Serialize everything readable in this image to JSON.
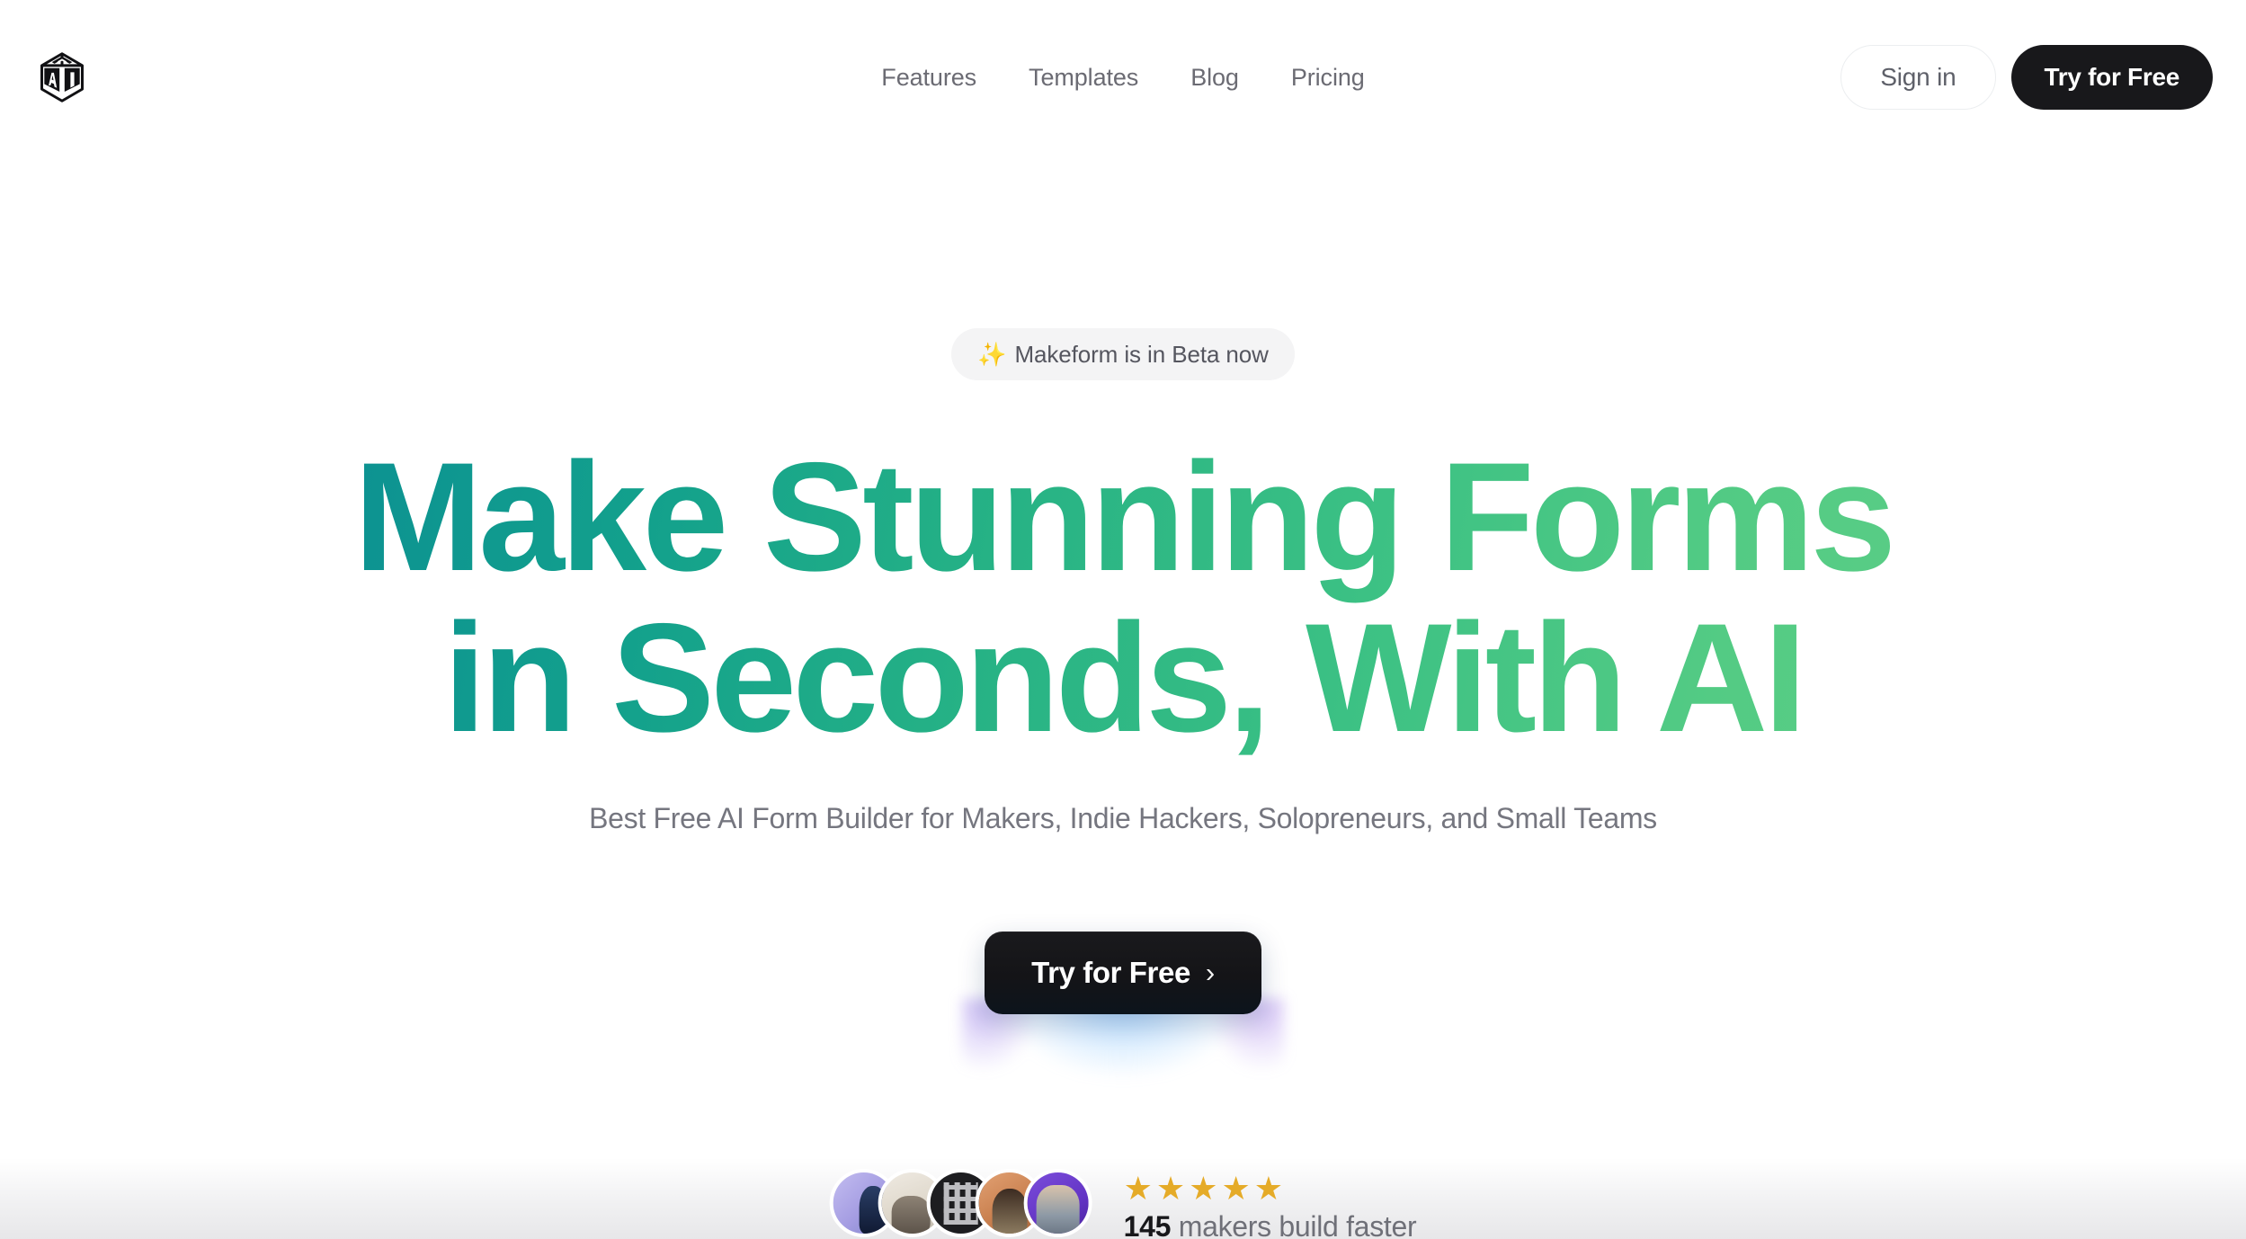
{
  "header": {
    "logo_alt": "Makeform FAI cube logo",
    "nav": [
      {
        "label": "Features"
      },
      {
        "label": "Templates"
      },
      {
        "label": "Blog"
      },
      {
        "label": "Pricing"
      }
    ],
    "sign_in_label": "Sign in",
    "try_free_label": "Try for Free"
  },
  "hero": {
    "badge": {
      "icon": "sparkles-icon",
      "icon_glyph": "✨",
      "text": "Makeform is in Beta now"
    },
    "headline_line1": "Make Stunning Forms",
    "headline_line2": "in Seconds, With AI",
    "subtitle": "Best Free AI Form Builder for Makers, Indie Hackers, Solopreneurs, and Small Teams",
    "cta_label": "Try for Free",
    "cta_chevron": "›"
  },
  "social_proof": {
    "avatar_count": 5,
    "avatars": [
      {
        "name": "avatar-1",
        "bg": "#a49ce2"
      },
      {
        "name": "avatar-2",
        "bg": "#ddd6c9"
      },
      {
        "name": "avatar-3",
        "bg": "#1d1d20"
      },
      {
        "name": "avatar-4",
        "bg": "#c9804f"
      },
      {
        "name": "avatar-5",
        "bg": "#6334c4"
      }
    ],
    "rating": 5,
    "star_glyph": "★",
    "count": "145",
    "count_suffix": "makers build faster"
  },
  "colors": {
    "headline_gradient_start": "#0b8f93",
    "headline_gradient_end": "#5bcd86",
    "dark_button": "#18181b",
    "nav_text": "#6b6b73",
    "subtitle_text": "#75767f",
    "badge_bg": "#f4f4f5",
    "star_gold": "#e5ab28",
    "page_bg": "#ffffff"
  }
}
